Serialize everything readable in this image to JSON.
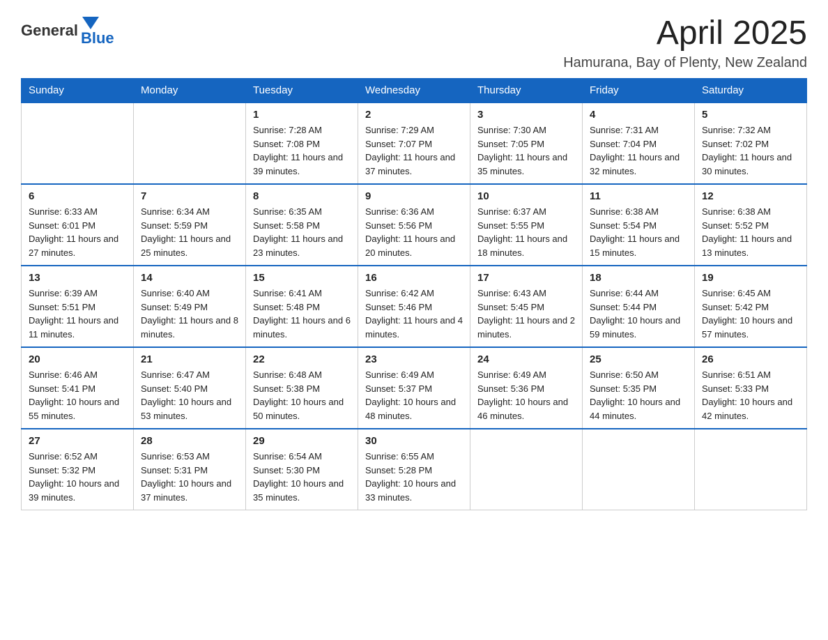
{
  "logo": {
    "text_general": "General",
    "text_blue": "Blue"
  },
  "title": {
    "month_year": "April 2025",
    "location": "Hamurana, Bay of Plenty, New Zealand"
  },
  "calendar": {
    "headers": [
      "Sunday",
      "Monday",
      "Tuesday",
      "Wednesday",
      "Thursday",
      "Friday",
      "Saturday"
    ],
    "weeks": [
      [
        {
          "day": "",
          "sunrise": "",
          "sunset": "",
          "daylight": ""
        },
        {
          "day": "",
          "sunrise": "",
          "sunset": "",
          "daylight": ""
        },
        {
          "day": "1",
          "sunrise": "Sunrise: 7:28 AM",
          "sunset": "Sunset: 7:08 PM",
          "daylight": "Daylight: 11 hours and 39 minutes."
        },
        {
          "day": "2",
          "sunrise": "Sunrise: 7:29 AM",
          "sunset": "Sunset: 7:07 PM",
          "daylight": "Daylight: 11 hours and 37 minutes."
        },
        {
          "day": "3",
          "sunrise": "Sunrise: 7:30 AM",
          "sunset": "Sunset: 7:05 PM",
          "daylight": "Daylight: 11 hours and 35 minutes."
        },
        {
          "day": "4",
          "sunrise": "Sunrise: 7:31 AM",
          "sunset": "Sunset: 7:04 PM",
          "daylight": "Daylight: 11 hours and 32 minutes."
        },
        {
          "day": "5",
          "sunrise": "Sunrise: 7:32 AM",
          "sunset": "Sunset: 7:02 PM",
          "daylight": "Daylight: 11 hours and 30 minutes."
        }
      ],
      [
        {
          "day": "6",
          "sunrise": "Sunrise: 6:33 AM",
          "sunset": "Sunset: 6:01 PM",
          "daylight": "Daylight: 11 hours and 27 minutes."
        },
        {
          "day": "7",
          "sunrise": "Sunrise: 6:34 AM",
          "sunset": "Sunset: 5:59 PM",
          "daylight": "Daylight: 11 hours and 25 minutes."
        },
        {
          "day": "8",
          "sunrise": "Sunrise: 6:35 AM",
          "sunset": "Sunset: 5:58 PM",
          "daylight": "Daylight: 11 hours and 23 minutes."
        },
        {
          "day": "9",
          "sunrise": "Sunrise: 6:36 AM",
          "sunset": "Sunset: 5:56 PM",
          "daylight": "Daylight: 11 hours and 20 minutes."
        },
        {
          "day": "10",
          "sunrise": "Sunrise: 6:37 AM",
          "sunset": "Sunset: 5:55 PM",
          "daylight": "Daylight: 11 hours and 18 minutes."
        },
        {
          "day": "11",
          "sunrise": "Sunrise: 6:38 AM",
          "sunset": "Sunset: 5:54 PM",
          "daylight": "Daylight: 11 hours and 15 minutes."
        },
        {
          "day": "12",
          "sunrise": "Sunrise: 6:38 AM",
          "sunset": "Sunset: 5:52 PM",
          "daylight": "Daylight: 11 hours and 13 minutes."
        }
      ],
      [
        {
          "day": "13",
          "sunrise": "Sunrise: 6:39 AM",
          "sunset": "Sunset: 5:51 PM",
          "daylight": "Daylight: 11 hours and 11 minutes."
        },
        {
          "day": "14",
          "sunrise": "Sunrise: 6:40 AM",
          "sunset": "Sunset: 5:49 PM",
          "daylight": "Daylight: 11 hours and 8 minutes."
        },
        {
          "day": "15",
          "sunrise": "Sunrise: 6:41 AM",
          "sunset": "Sunset: 5:48 PM",
          "daylight": "Daylight: 11 hours and 6 minutes."
        },
        {
          "day": "16",
          "sunrise": "Sunrise: 6:42 AM",
          "sunset": "Sunset: 5:46 PM",
          "daylight": "Daylight: 11 hours and 4 minutes."
        },
        {
          "day": "17",
          "sunrise": "Sunrise: 6:43 AM",
          "sunset": "Sunset: 5:45 PM",
          "daylight": "Daylight: 11 hours and 2 minutes."
        },
        {
          "day": "18",
          "sunrise": "Sunrise: 6:44 AM",
          "sunset": "Sunset: 5:44 PM",
          "daylight": "Daylight: 10 hours and 59 minutes."
        },
        {
          "day": "19",
          "sunrise": "Sunrise: 6:45 AM",
          "sunset": "Sunset: 5:42 PM",
          "daylight": "Daylight: 10 hours and 57 minutes."
        }
      ],
      [
        {
          "day": "20",
          "sunrise": "Sunrise: 6:46 AM",
          "sunset": "Sunset: 5:41 PM",
          "daylight": "Daylight: 10 hours and 55 minutes."
        },
        {
          "day": "21",
          "sunrise": "Sunrise: 6:47 AM",
          "sunset": "Sunset: 5:40 PM",
          "daylight": "Daylight: 10 hours and 53 minutes."
        },
        {
          "day": "22",
          "sunrise": "Sunrise: 6:48 AM",
          "sunset": "Sunset: 5:38 PM",
          "daylight": "Daylight: 10 hours and 50 minutes."
        },
        {
          "day": "23",
          "sunrise": "Sunrise: 6:49 AM",
          "sunset": "Sunset: 5:37 PM",
          "daylight": "Daylight: 10 hours and 48 minutes."
        },
        {
          "day": "24",
          "sunrise": "Sunrise: 6:49 AM",
          "sunset": "Sunset: 5:36 PM",
          "daylight": "Daylight: 10 hours and 46 minutes."
        },
        {
          "day": "25",
          "sunrise": "Sunrise: 6:50 AM",
          "sunset": "Sunset: 5:35 PM",
          "daylight": "Daylight: 10 hours and 44 minutes."
        },
        {
          "day": "26",
          "sunrise": "Sunrise: 6:51 AM",
          "sunset": "Sunset: 5:33 PM",
          "daylight": "Daylight: 10 hours and 42 minutes."
        }
      ],
      [
        {
          "day": "27",
          "sunrise": "Sunrise: 6:52 AM",
          "sunset": "Sunset: 5:32 PM",
          "daylight": "Daylight: 10 hours and 39 minutes."
        },
        {
          "day": "28",
          "sunrise": "Sunrise: 6:53 AM",
          "sunset": "Sunset: 5:31 PM",
          "daylight": "Daylight: 10 hours and 37 minutes."
        },
        {
          "day": "29",
          "sunrise": "Sunrise: 6:54 AM",
          "sunset": "Sunset: 5:30 PM",
          "daylight": "Daylight: 10 hours and 35 minutes."
        },
        {
          "day": "30",
          "sunrise": "Sunrise: 6:55 AM",
          "sunset": "Sunset: 5:28 PM",
          "daylight": "Daylight: 10 hours and 33 minutes."
        },
        {
          "day": "",
          "sunrise": "",
          "sunset": "",
          "daylight": ""
        },
        {
          "day": "",
          "sunrise": "",
          "sunset": "",
          "daylight": ""
        },
        {
          "day": "",
          "sunrise": "",
          "sunset": "",
          "daylight": ""
        }
      ]
    ]
  }
}
